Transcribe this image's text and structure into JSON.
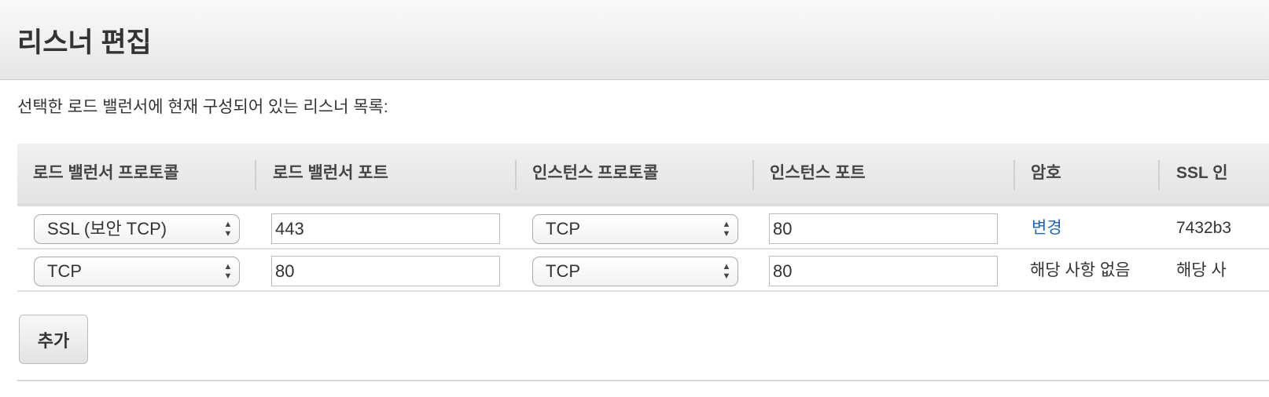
{
  "title": "리스너 편집",
  "subtitle": "선택한 로드 밸런서에 현재 구성되어 있는 리스너 목록:",
  "columns": [
    "로드 밸런서 프로토콜",
    "로드 밸런서 포트",
    "인스턴스 프로토콜",
    "인스턴스 포트",
    "암호",
    "SSL 인"
  ],
  "rows": [
    {
      "lb_protocol": "SSL (보안 TCP)",
      "lb_port": "443",
      "instance_protocol": "TCP",
      "instance_port": "80",
      "cipher": "변경",
      "ssl": "7432b3"
    },
    {
      "lb_protocol": "TCP",
      "lb_port": "80",
      "instance_protocol": "TCP",
      "instance_port": "80",
      "cipher": "해당 사항 없음",
      "ssl": "해당 사"
    }
  ],
  "add_label": "추가",
  "colors": {
    "link": "#1d64c0"
  }
}
